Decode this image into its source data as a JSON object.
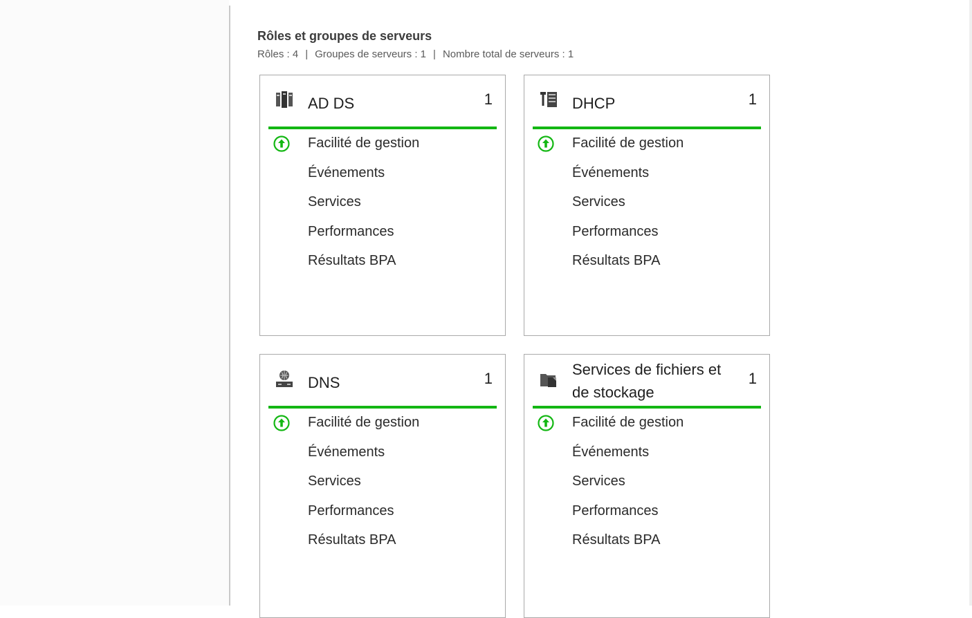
{
  "section": {
    "title": "Rôles et groupes de serveurs",
    "roles_label": "Rôles : 4",
    "groups_label": "Groupes de serveurs : 1",
    "total_label": "Nombre total de serveurs : 1",
    "separator": "|"
  },
  "colors": {
    "status_green": "#13b713",
    "border": "#a9a9a9"
  },
  "tiles": [
    {
      "title": "AD DS",
      "count": "1",
      "icon": "ad-ds-icon",
      "items": [
        "Facilité de gestion",
        "Événements",
        "Services",
        "Performances",
        "Résultats BPA"
      ]
    },
    {
      "title": "DHCP",
      "count": "1",
      "icon": "dhcp-icon",
      "items": [
        "Facilité de gestion",
        "Événements",
        "Services",
        "Performances",
        "Résultats BPA"
      ]
    },
    {
      "title": "DNS",
      "count": "1",
      "icon": "dns-icon",
      "items": [
        "Facilité de gestion",
        "Événements",
        "Services",
        "Performances",
        "Résultats BPA"
      ]
    },
    {
      "title_line1": "Services de fichiers et",
      "title_line2": "de stockage",
      "count": "1",
      "icon": "file-storage-icon",
      "items": [
        "Facilité de gestion",
        "Événements",
        "Services",
        "Performances",
        "Résultats BPA"
      ]
    }
  ]
}
